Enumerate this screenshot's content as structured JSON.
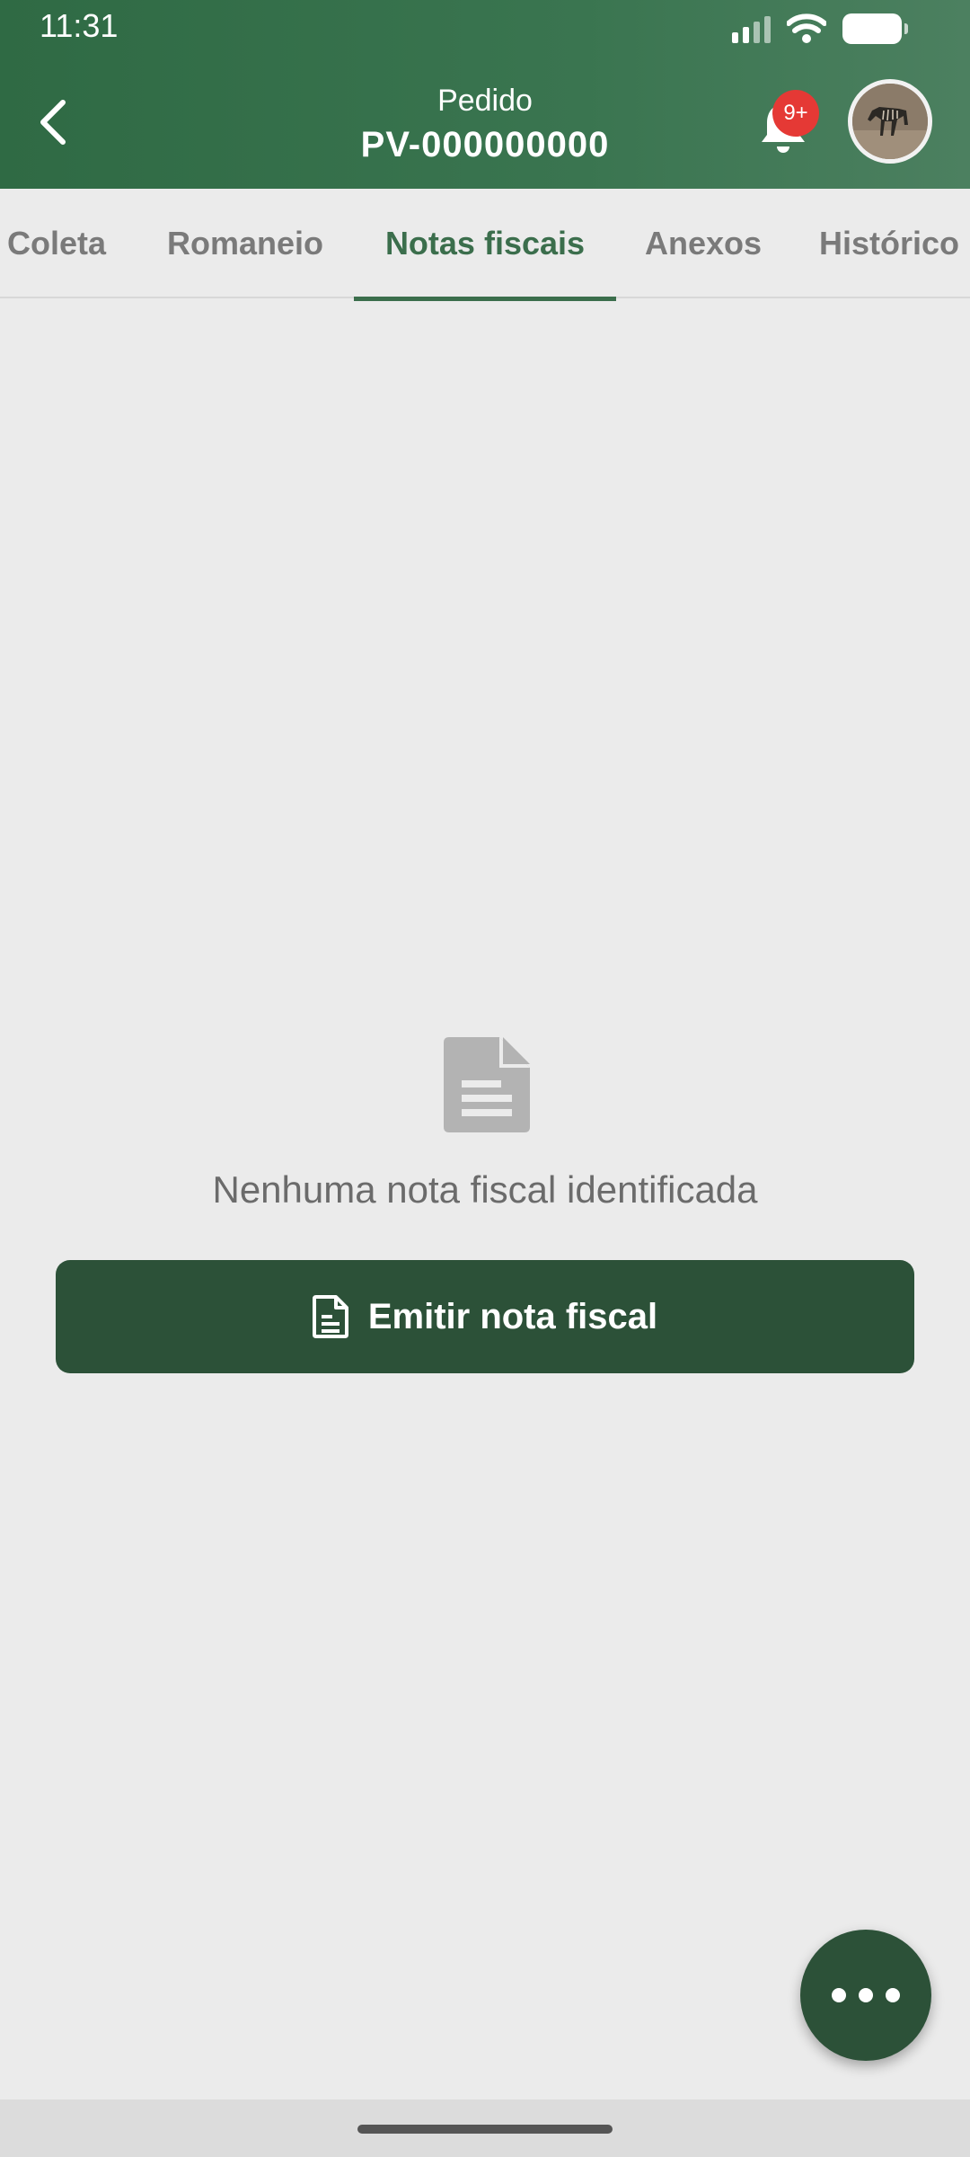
{
  "status_bar": {
    "time": "11:31"
  },
  "app_bar": {
    "subtitle": "Pedido",
    "title": "PV-000000000",
    "notification_badge": "9+",
    "colors": {
      "primary": "#2c5138",
      "header": "#3a7550",
      "badge": "#e53935"
    }
  },
  "tabs": [
    {
      "label": "Coleta",
      "active": false
    },
    {
      "label": "Romaneio",
      "active": false
    },
    {
      "label": "Notas fiscais",
      "active": true
    },
    {
      "label": "Anexos",
      "active": false
    },
    {
      "label": "Histórico",
      "active": false
    }
  ],
  "empty_state": {
    "icon": "document-icon",
    "message": "Nenhuma nota fiscal identificada"
  },
  "primary_action": {
    "label": "Emitir nota fiscal",
    "icon": "document-outline-icon"
  },
  "fab": {
    "icon": "more-horizontal-icon"
  }
}
